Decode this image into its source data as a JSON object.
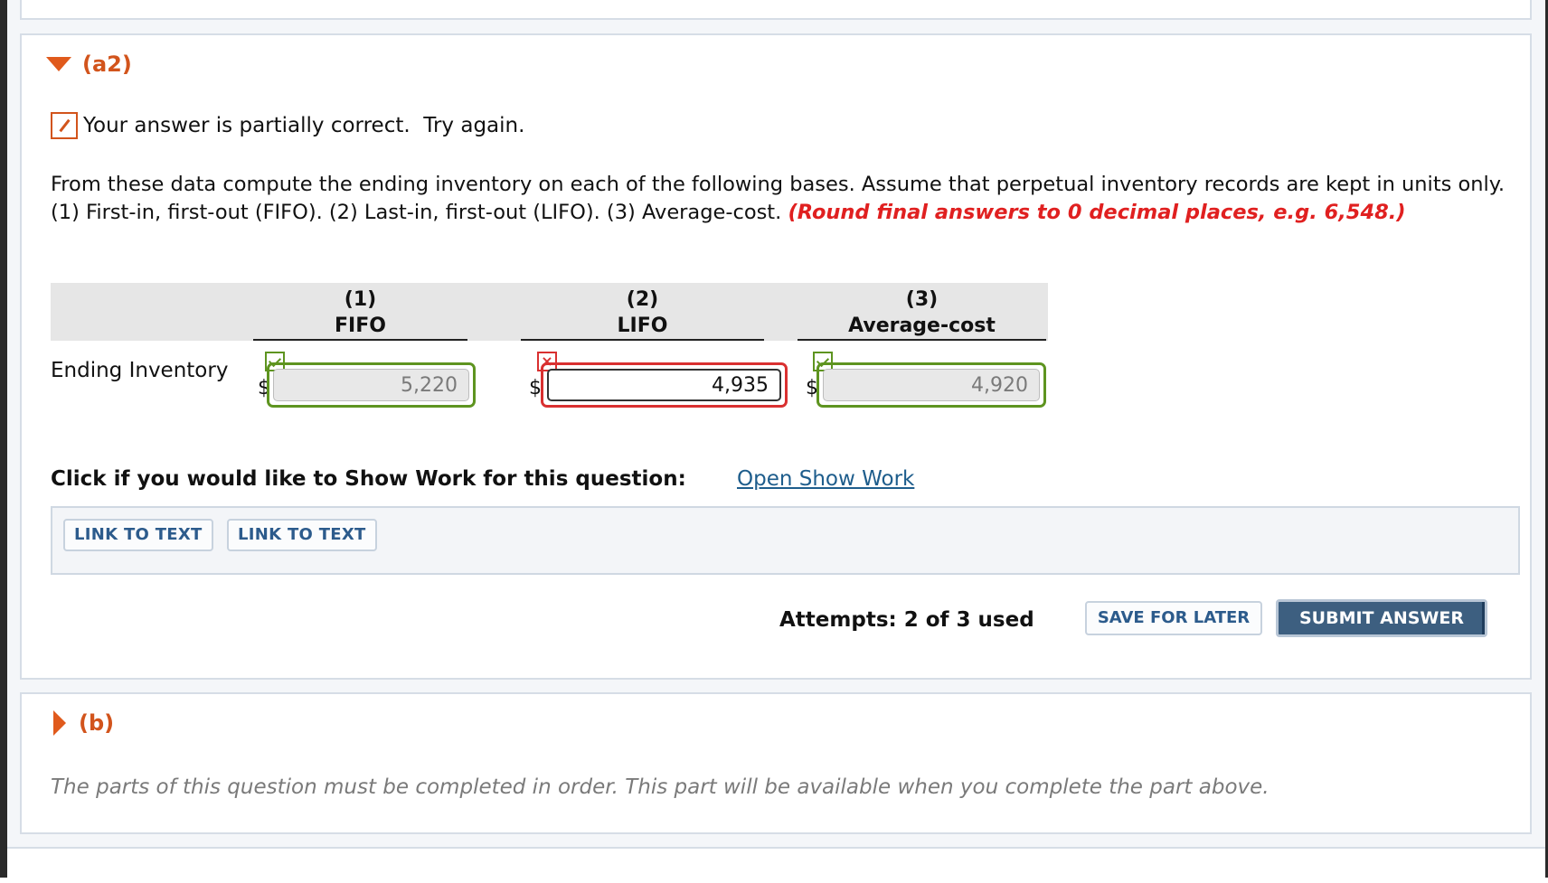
{
  "part_a2": {
    "label": "(a2)",
    "status": "Your answer is partially correct.  Try again.",
    "question": "From these data compute the ending inventory on each of the following bases. Assume that perpetual inventory records are kept in units only. (1) First-in, first-out (FIFO). (2) Last-in, first-out (LIFO). (3) Average-cost.",
    "hint": "(Round final answers to 0 decimal places, e.g. 6,548.)",
    "table": {
      "row_label": "Ending Inventory",
      "currency": "$",
      "columns": [
        {
          "num": "(1)",
          "name": "FIFO",
          "value": "5,220",
          "status": "correct"
        },
        {
          "num": "(2)",
          "name": "LIFO",
          "value": "4,935",
          "status": "incorrect"
        },
        {
          "num": "(3)",
          "name": "Average-cost",
          "value": "4,920",
          "status": "correct"
        }
      ]
    },
    "show_work_prompt": "Click if you would like to Show Work for this question:",
    "show_work_link": "Open Show Work",
    "link_buttons": [
      "LINK TO TEXT",
      "LINK TO TEXT"
    ],
    "attempts": "Attempts: 2 of 3 used",
    "save_label": "SAVE FOR LATER",
    "submit_label": "SUBMIT ANSWER"
  },
  "part_b": {
    "label": "(b)",
    "note": "The parts of this question must be completed in order. This part will be available when you complete the part above."
  },
  "colors": {
    "accent_orange": "#d2541c",
    "hint_red": "#e02020",
    "correct_green": "#5e9420",
    "incorrect_red": "#d93030",
    "link_blue": "#1e5d8c",
    "submit_bg": "#3d5f80"
  },
  "icons": {
    "expanded": "triangle-down-icon",
    "collapsed": "triangle-right-icon",
    "status": "pencil-icon",
    "correct": "check-icon",
    "incorrect": "x-icon"
  }
}
